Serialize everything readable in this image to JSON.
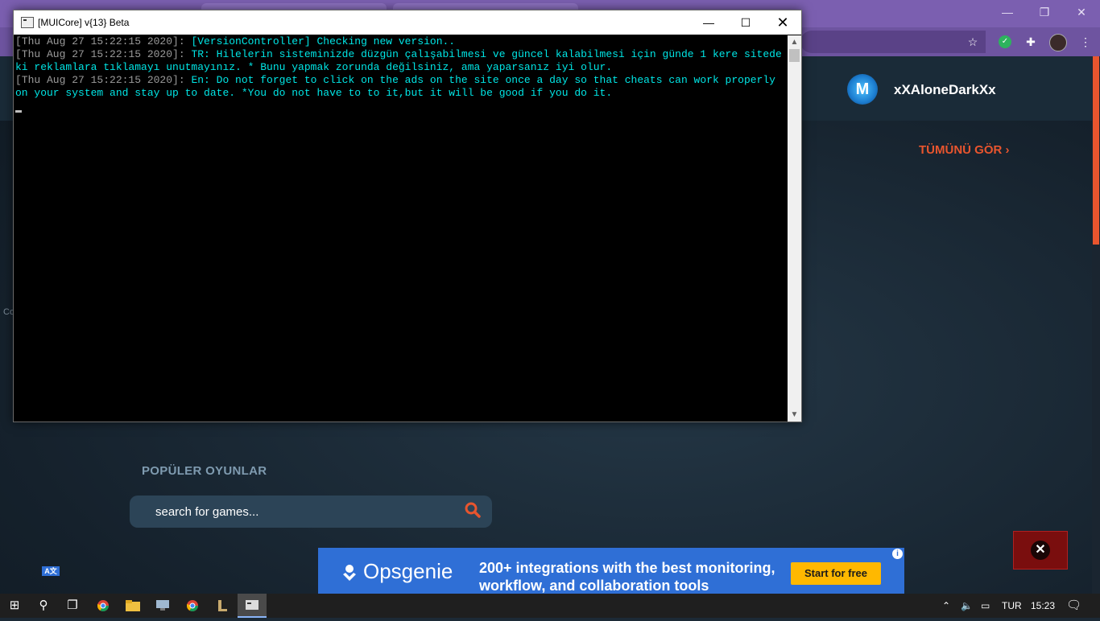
{
  "console": {
    "title": "[MUICore] v{13} Beta",
    "lines": [
      {
        "ts": "[Thu Aug 27 15:22:15 2020]:",
        "msg": " [VersionController] Checking new version.."
      },
      {
        "ts": "[Thu Aug 27 15:22:15 2020]:",
        "msg": " TR: Hilelerin sisteminizde düzgün çalışabilmesi ve güncel kalabilmesi için günde 1 kere sitedeki reklamlara tıklamayı unutmayınız. * Bunu yapmak zorunda değilsiniz, ama yaparsanız iyi olur."
      },
      {
        "ts": "[Thu Aug 27 15:22:15 2020]:",
        "msg": " En: Do not forget to click on the ads on the site once a day so that cheats can work properly on your system and stay up to date. *You do not have to to it,but it will be good if you do it."
      }
    ],
    "minimize": "—",
    "maximize": "☐",
    "close": "✕"
  },
  "site": {
    "username": "xXAloneDarkXx",
    "logo_letter": "M",
    "see_all": "TÜMÜNÜ GÖR ›",
    "popular_title": "POPÜLER OYUNLAR",
    "search_placeholder": "search for games...",
    "stray_label": "Co",
    "translate_badge": "A文",
    "close_ad": "✕"
  },
  "ad": {
    "brand": "Opsgenie",
    "headline": "200+ integrations with the best monitoring, workflow, and collaboration tools",
    "cta": "Start for free",
    "info": "i"
  },
  "taskbar": {
    "start": "⊞",
    "search": "⚲",
    "task_view": "❐",
    "language": "TUR",
    "time": "15:23",
    "notifications": "🗨"
  },
  "colors": {
    "accent": "#e8552e",
    "console_text": "#00e5e5",
    "ad_blue": "#2f6fd6",
    "cta_yellow": "#ffb800"
  }
}
